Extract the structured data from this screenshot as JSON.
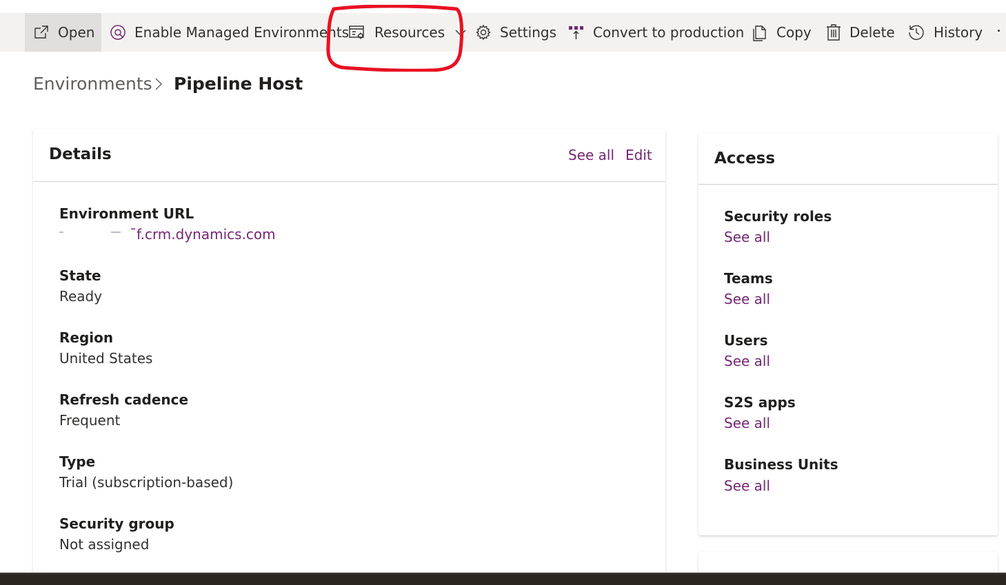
{
  "toolbar": {
    "items": [
      {
        "label": "Open",
        "icon": "open-in-new-icon"
      },
      {
        "label": "Enable Managed Environments",
        "icon": "managed-environment-icon"
      },
      {
        "label": "Resources",
        "icon": "resources-icon"
      },
      {
        "label": "Settings",
        "icon": "gear-icon"
      },
      {
        "label": "Convert to production",
        "icon": "convert-icon"
      },
      {
        "label": "Copy",
        "icon": "copy-icon"
      },
      {
        "label": "Delete",
        "icon": "trash-icon"
      },
      {
        "label": "History",
        "icon": "history-icon"
      }
    ]
  },
  "breadcrumb": {
    "root": "Environments",
    "current": "Pipeline Host"
  },
  "details": {
    "title": "Details",
    "see_all": "See all",
    "edit": "Edit",
    "fields": [
      {
        "label": "Environment URL",
        "value": "ˉf.crm.dynamics.com"
      },
      {
        "label": "State",
        "value": "Ready"
      },
      {
        "label": "Region",
        "value": "United States"
      },
      {
        "label": "Refresh cadence",
        "value": "Frequent"
      },
      {
        "label": "Type",
        "value": "Trial (subscription-based)"
      },
      {
        "label": "Security group",
        "value": "Not assigned"
      }
    ]
  },
  "access": {
    "title": "Access",
    "items": [
      {
        "label": "Security roles",
        "link": "See all"
      },
      {
        "label": "Teams",
        "link": "See all"
      },
      {
        "label": "Users",
        "link": "See all"
      },
      {
        "label": "S2S apps",
        "link": "See all"
      },
      {
        "label": "Business Units",
        "link": "See all"
      }
    ]
  },
  "colors": {
    "link": "#742774",
    "toolbar_bg": "#f3f2f1",
    "annotation": "#e81123"
  }
}
